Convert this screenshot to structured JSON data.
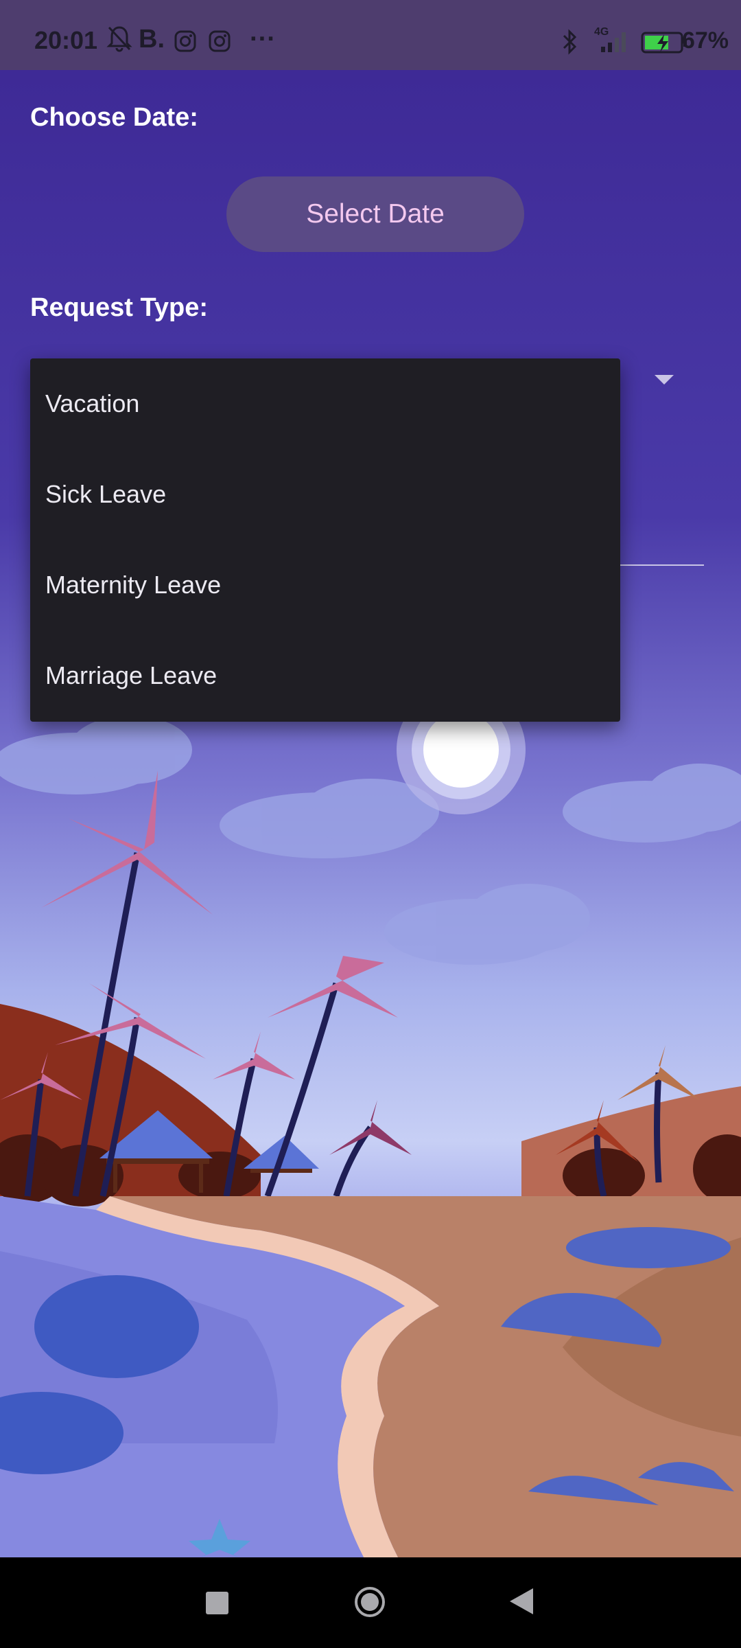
{
  "status_bar": {
    "time": "20:01",
    "left_icons": [
      "bell-muted-icon",
      "b-app-icon",
      "instagram-icon",
      "instagram-icon",
      "more-dots-icon"
    ],
    "b_text": "B.",
    "more_text": "···",
    "network_text": "4G",
    "battery_percent": "67%",
    "right_icons": [
      "bluetooth-icon",
      "signal-icon",
      "battery-charging-icon"
    ]
  },
  "form": {
    "choose_date_label": "Choose Date:",
    "select_date_button": "Select Date",
    "request_type_label": "Request Type:"
  },
  "dropdown": {
    "options": [
      "Vacation",
      "Sick Leave",
      "Maternity Leave",
      "Marriage Leave"
    ]
  },
  "nav_bar": {
    "buttons": [
      "recents-square-icon",
      "home-circle-icon",
      "back-triangle-icon"
    ]
  },
  "colors": {
    "accent_button": "#5a4a86",
    "button_text": "#f4c9ef",
    "menu_bg": "#1f1e24"
  }
}
